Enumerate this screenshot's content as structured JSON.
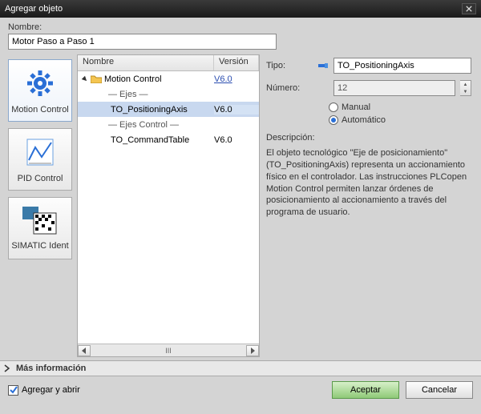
{
  "title": "Agregar objeto",
  "name_label": "Nombre:",
  "name_value": "Motor Paso a Paso 1",
  "categories": [
    {
      "id": "motion",
      "label": "Motion Control"
    },
    {
      "id": "pid",
      "label": "PID Control"
    },
    {
      "id": "ident",
      "label": "SIMATIC Ident"
    }
  ],
  "tree": {
    "col_name": "Nombre",
    "col_version": "Versión",
    "root": {
      "label": "Motion Control",
      "version": "V6.0"
    },
    "groups": [
      "— Ejes —",
      "— Ejes Control —"
    ],
    "items": [
      {
        "label": "TO_PositioningAxis",
        "version": "V6.0"
      },
      {
        "label": "TO_CommandTable",
        "version": "V6.0"
      }
    ]
  },
  "props": {
    "type_label": "Tipo:",
    "type_value": "TO_PositioningAxis",
    "number_label": "Número:",
    "number_value": "12",
    "manual": "Manual",
    "auto": "Automático"
  },
  "descr_head": "Descripción:",
  "descr_text": "El objeto tecnológico \"Eje de posicionamiento\" (TO_PositioningAxis) representa un accionamiento físico en el controlador. Las instrucciones PLCopen Motion Control permiten lanzar órdenes de posicionamiento al accionamiento a través del programa de usuario.",
  "more_info": "Más información",
  "open_after": "Agregar y abrir",
  "ok": "Aceptar",
  "cancel": "Cancelar"
}
